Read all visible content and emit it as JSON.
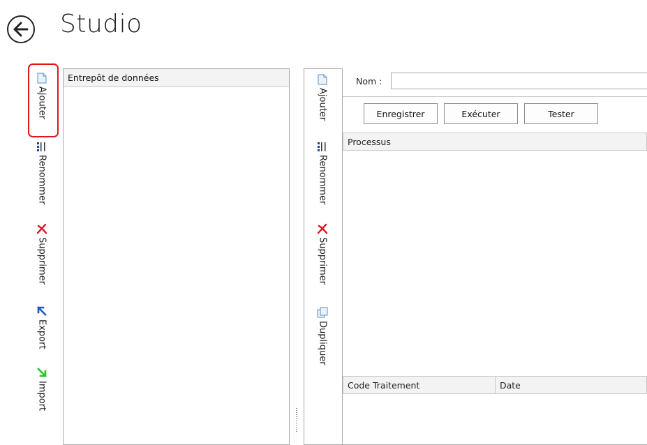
{
  "header": {
    "title": "Studio"
  },
  "left_toolbar": {
    "items": [
      {
        "label": "Ajouter",
        "icon": "new-document-icon"
      },
      {
        "label": "Renommer",
        "icon": "rename-icon"
      },
      {
        "label": "Supprimer",
        "icon": "delete-icon"
      },
      {
        "label": "Export",
        "icon": "export-arrow-icon"
      },
      {
        "label": "Import",
        "icon": "import-arrow-icon"
      }
    ]
  },
  "warehouse_panel": {
    "header": "Entrepôt de données"
  },
  "right_toolbar": {
    "items": [
      {
        "label": "Ajouter",
        "icon": "new-document-icon"
      },
      {
        "label": "Renommer",
        "icon": "rename-icon"
      },
      {
        "label": "Supprimer",
        "icon": "delete-icon"
      },
      {
        "label": "Dupliquer",
        "icon": "duplicate-icon"
      }
    ]
  },
  "editor": {
    "name_label": "Nom :",
    "name_value": "",
    "buttons": {
      "save": "Enregistrer",
      "execute": "Exécuter",
      "test": "Tester"
    },
    "process_header": "Processus",
    "columns": [
      "Code Traitement",
      "Date"
    ]
  },
  "colors": {
    "highlight": "#e3151a",
    "delete_red": "#d9141b",
    "export_blue": "#1e5bb8",
    "import_green": "#2bc22b"
  }
}
